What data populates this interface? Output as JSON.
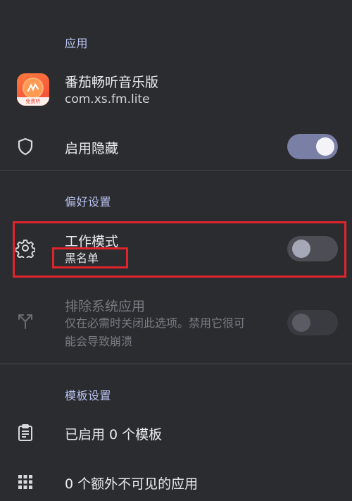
{
  "sections": {
    "app": "应用",
    "preferences": "偏好设置",
    "templates": "模板设置"
  },
  "app_info": {
    "name": "番茄畅听音乐版",
    "package": "com.xs.fm.lite",
    "icon_badge": "免费听"
  },
  "hide_app": {
    "label": "启用隐藏",
    "enabled": true
  },
  "work_mode": {
    "label": "工作模式",
    "value": "黑名单",
    "enabled": false
  },
  "exclude_system": {
    "label": "排除系统应用",
    "desc_line1": "仅在必需时关闭此选项。禁用它很可",
    "desc_line2": "能会导致崩溃",
    "enabled": false
  },
  "templates": {
    "enabled_count": "已启用 0 个模板",
    "extra_invisible": "0 个额外不可见的应用"
  },
  "colors": {
    "background": "#2b2c30",
    "accent": "#b9c3ee",
    "highlight": "#e0242b"
  }
}
